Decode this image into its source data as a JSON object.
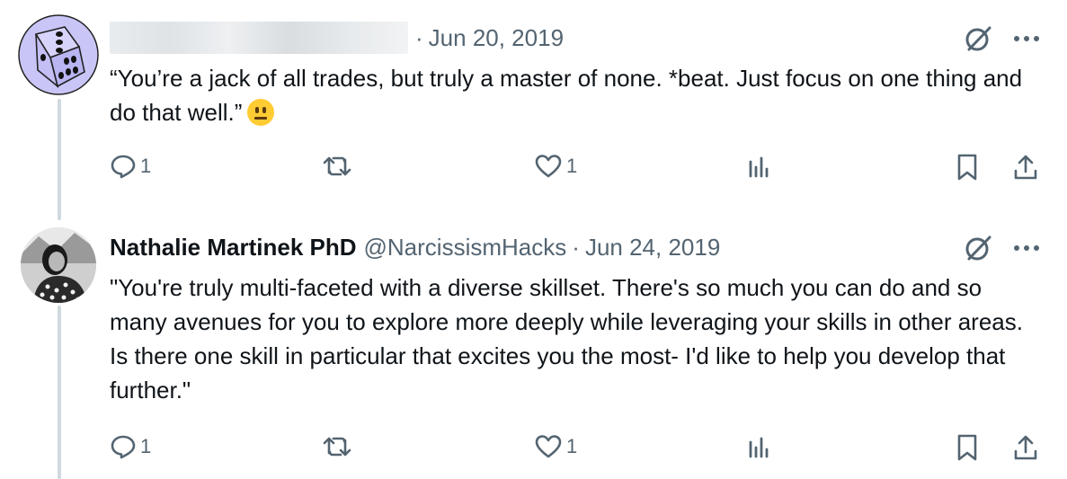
{
  "tweets": [
    {
      "name": "",
      "handle": "",
      "date": "Jun 20, 2019",
      "text": "“You’re a jack of all trades, but truly a master of none. *beat.   Just focus on one thing and do that well.”",
      "emoji": "neutral-face",
      "reply_count": "1",
      "retweet_count": "",
      "like_count": "1"
    },
    {
      "name": "Nathalie Martinek PhD",
      "handle": "@NarcissismHacks",
      "date": "Jun 24, 2019",
      "text": "\"You're truly multi-faceted with a diverse skillset. There's so much you can do and so many avenues for you to explore more deeply while leveraging your skills in other areas. Is there one skill in particular that excites you the most- I'd like to help you develop that further.\"",
      "reply_count": "1",
      "retweet_count": "",
      "like_count": "1"
    }
  ],
  "separator": "·",
  "colors": {
    "thread_line": "#cfd9de",
    "muted": "#536471",
    "text": "#0f1419",
    "avatar_dice": "#c9c6f7"
  }
}
